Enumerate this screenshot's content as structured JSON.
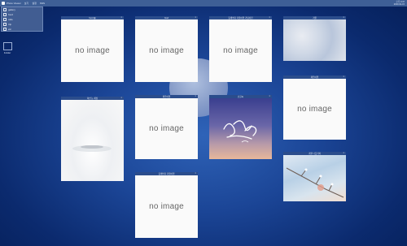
{
  "topbar": {
    "app": "Photo Viewer",
    "items": [
      "보기",
      "설정",
      "SNS"
    ],
    "clock": "오후 3:47",
    "date": "2023-02-15"
  },
  "dropdown": {
    "items": [
      "gallery",
      "food",
      "cafe",
      "trip",
      "etc"
    ]
  },
  "desktop_icon": {
    "label": "Folder"
  },
  "placeholder": "no image",
  "cards": [
    {
      "title": "food ▦",
      "image": "none"
    },
    {
      "title": "food",
      "image": "none"
    },
    {
      "title": "동해바다 겨울여행 기념사진",
      "image": "none"
    },
    {
      "title": "겨울",
      "image": "snow-texture"
    },
    {
      "title": "하얀 눈 세상",
      "image": "snow-field"
    },
    {
      "title": "제주여행",
      "image": "none"
    },
    {
      "title": "손글씨",
      "image": "calligraphy"
    },
    {
      "title": "제주여행",
      "image": "none"
    },
    {
      "title": "겨울 나뭇가지",
      "image": "frost-branch"
    },
    {
      "title": "동해바다 겨울여행",
      "image": "none"
    }
  ]
}
